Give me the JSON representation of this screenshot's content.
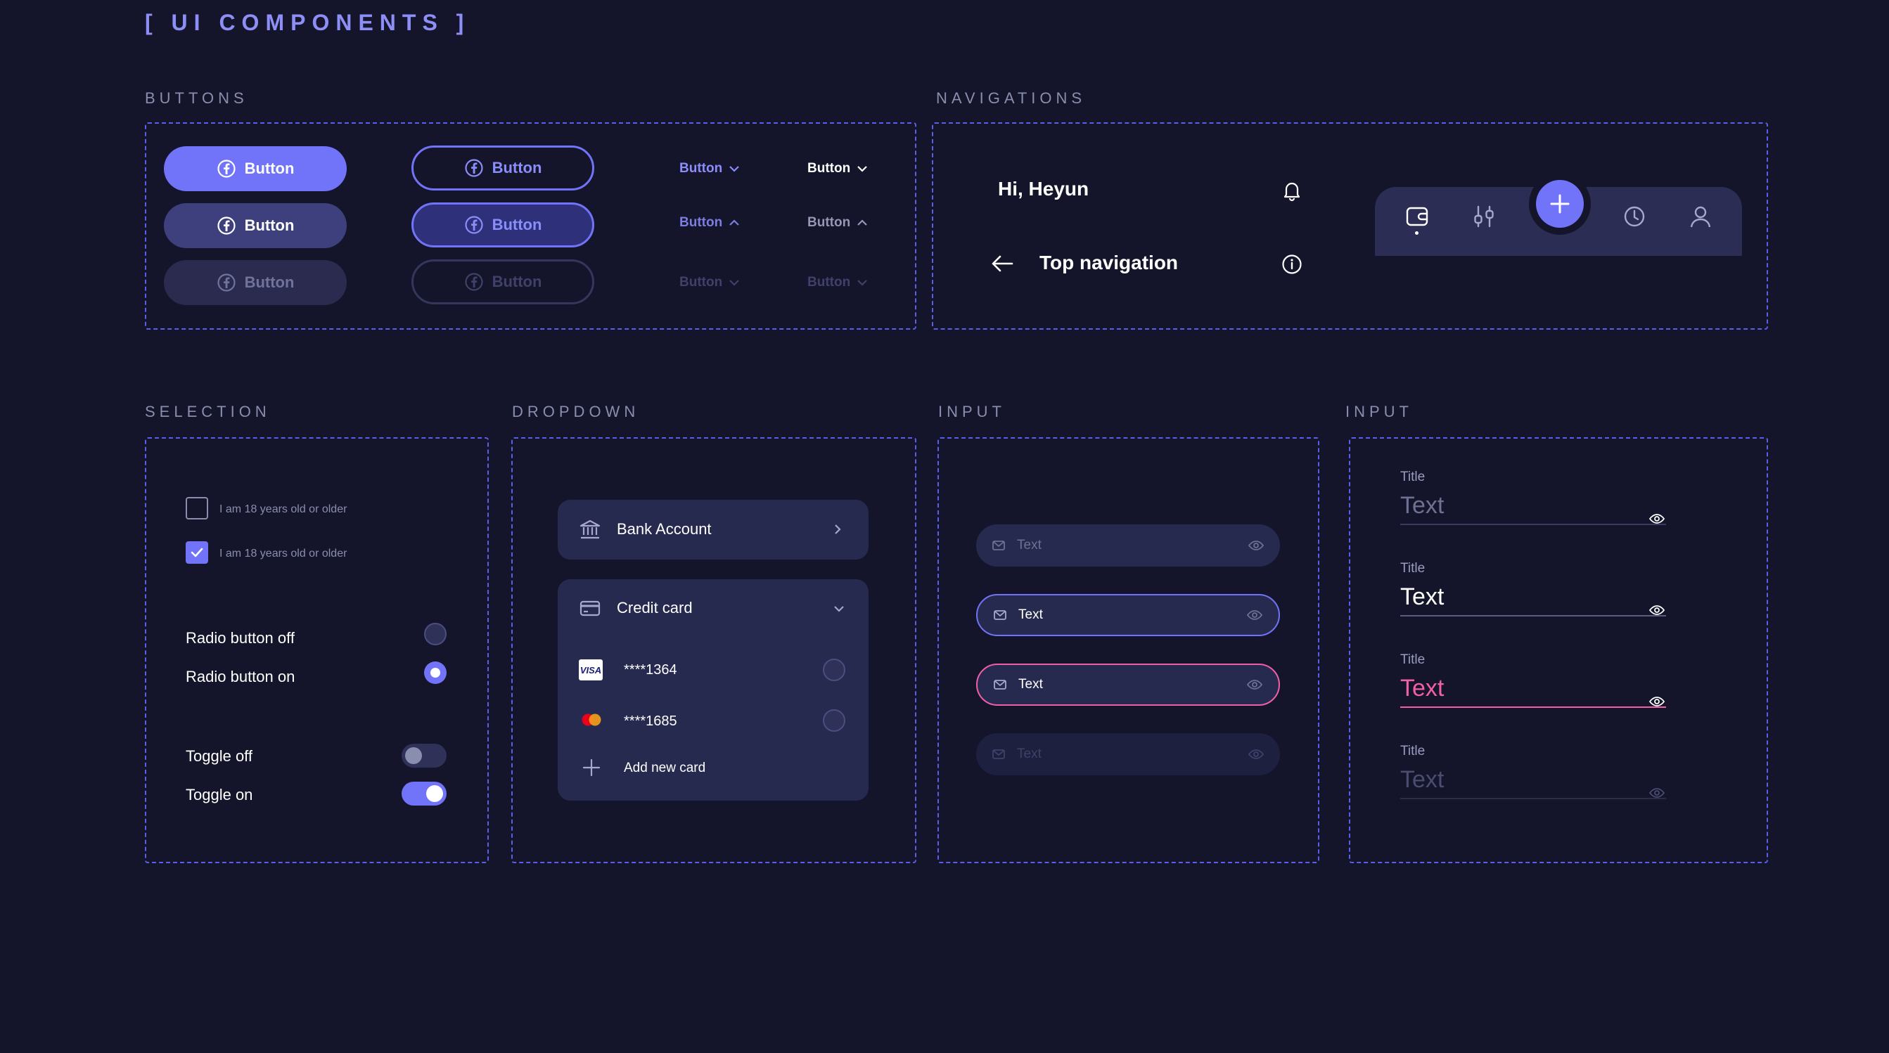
{
  "page_title": "[  UI COMPONENTS ]",
  "sections": {
    "buttons": "BUTTONS",
    "navigations": "NAVIGATIONS",
    "selection": "SELECTION",
    "dropdown": "DROPDOWN",
    "input1": "INPUT",
    "input2": "INPUT"
  },
  "buttons": {
    "label": "Button",
    "states": [
      "default",
      "pressed",
      "disabled"
    ]
  },
  "navigation": {
    "greeting": "Hi, Heyun",
    "top_nav_title": "Top navigation",
    "tabbar_icons": [
      "wallet-icon",
      "sliders-icon",
      "plus-icon",
      "clock-icon",
      "user-icon"
    ]
  },
  "selection": {
    "checkbox_off_label": "I am 18 years old or older",
    "checkbox_on_label": "I am 18 years old or older",
    "radio_off_label": "Radio button off",
    "radio_on_label": "Radio button on",
    "toggle_off_label": "Toggle off",
    "toggle_on_label": "Toggle on"
  },
  "dropdown": {
    "bank_account": "Bank Account",
    "credit_card": "Credit card",
    "cards": [
      {
        "brand": "VISA",
        "number": "****1364"
      },
      {
        "brand": "mastercard",
        "number": "****1685"
      }
    ],
    "add_new_card": "Add new card"
  },
  "inputs": {
    "pill_text": "Text",
    "states": [
      "placeholder",
      "focused",
      "error",
      "disabled"
    ]
  },
  "underline_inputs": {
    "title": "Title",
    "text": "Text",
    "colors": {
      "placeholder": "#6e7191",
      "filled": "#ffffff",
      "error": "#f15fa6",
      "disabled": "#4a4c70"
    }
  },
  "colors": {
    "background": "#14152a",
    "accent": "#7173f8",
    "error": "#f15fa6"
  }
}
